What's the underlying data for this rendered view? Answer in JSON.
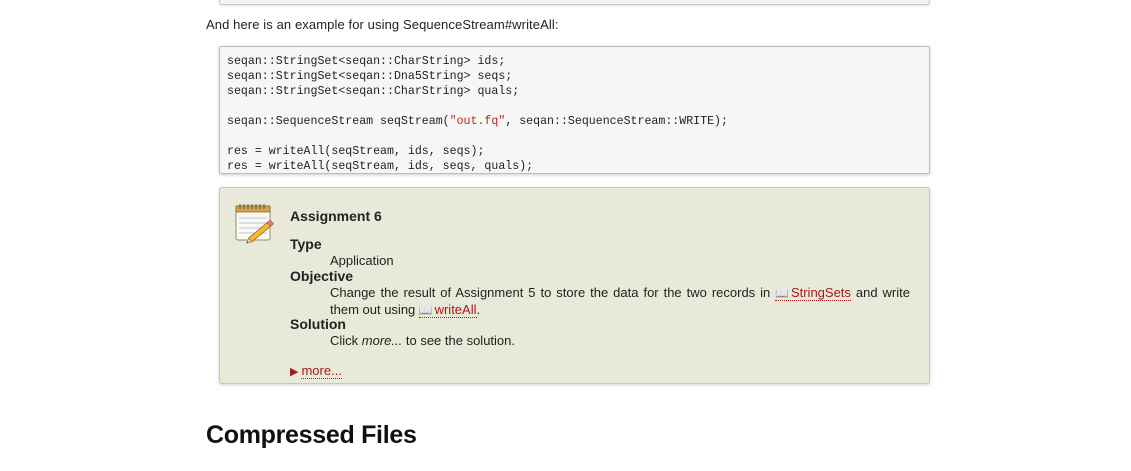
{
  "intro_text": "And here is an example for using SequenceStream#writeAll:",
  "code": {
    "line1": "seqan::StringSet<seqan::CharString> ids;",
    "line2": "seqan::StringSet<seqan::Dna5String> seqs;",
    "line3": "seqan::StringSet<seqan::CharString> quals;",
    "line4_a": "seqan::SequenceStream seqStream(",
    "line4_str": "\"out.fq\"",
    "line4_b": ", seqan::SequenceStream::WRITE);",
    "line5": "res = writeAll(seqStream, ids, seqs);",
    "line6": "res = writeAll(seqStream, ids, seqs, quals);"
  },
  "assignment": {
    "title": "Assignment 6",
    "type_label": "Type",
    "type_value": "Application",
    "objective_label": "Objective",
    "objective_pre": "Change the result of Assignment 5 to store the data for the two records in ",
    "link1": "StringSets",
    "objective_mid": " and write them out using ",
    "link2": "writeAll",
    "objective_post": ".",
    "solution_label": "Solution",
    "solution_pre": "Click ",
    "solution_em": "more...",
    "solution_post": " to see the solution.",
    "more_label": "more..."
  },
  "section_heading": "Compressed Files",
  "colors": {
    "link": "#a51a1a",
    "assignment_bg": "#e9e9d9",
    "code_bg": "#f6f6f6"
  },
  "icons": {
    "assignment": "notepad-pencil-icon",
    "xref": "open-book-icon",
    "expand": "triangle-right-icon"
  }
}
